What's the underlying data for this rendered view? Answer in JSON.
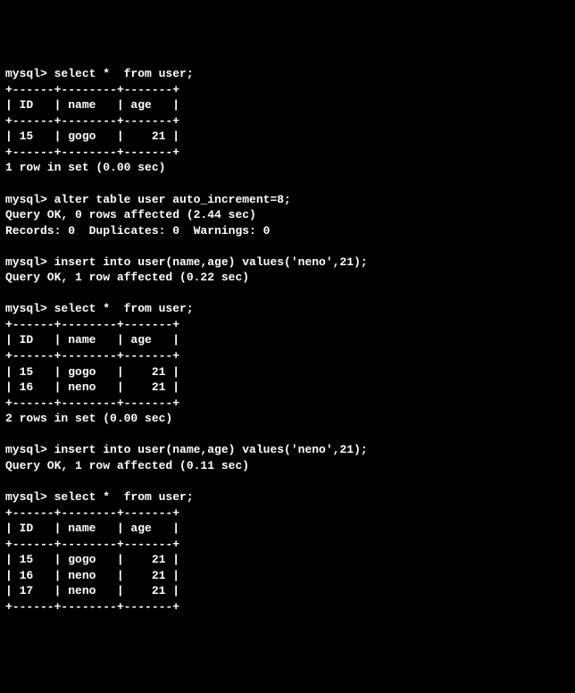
{
  "prompt": "mysql> ",
  "blocks": [
    {
      "type": "cmd",
      "text": "select *  from user;"
    },
    {
      "type": "table",
      "cols": [
        "ID",
        "name",
        "age"
      ],
      "cws": [
        4,
        6,
        5
      ],
      "rows": [
        [
          "15",
          "gogo",
          "21"
        ]
      ]
    },
    {
      "type": "line",
      "text": "1 row in set (0.00 sec)"
    },
    {
      "type": "blank"
    },
    {
      "type": "cmd",
      "text": "alter table user auto_increment=8;"
    },
    {
      "type": "line",
      "text": "Query OK, 0 rows affected (2.44 sec)"
    },
    {
      "type": "line",
      "text": "Records: 0  Duplicates: 0  Warnings: 0"
    },
    {
      "type": "blank"
    },
    {
      "type": "cmd",
      "text": "insert into user(name,age) values('neno',21);"
    },
    {
      "type": "line",
      "text": "Query OK, 1 row affected (0.22 sec)"
    },
    {
      "type": "blank"
    },
    {
      "type": "cmd",
      "text": "select *  from user;"
    },
    {
      "type": "table",
      "cols": [
        "ID",
        "name",
        "age"
      ],
      "cws": [
        4,
        6,
        5
      ],
      "rows": [
        [
          "15",
          "gogo",
          "21"
        ],
        [
          "16",
          "neno",
          "21"
        ]
      ]
    },
    {
      "type": "line",
      "text": "2 rows in set (0.00 sec)"
    },
    {
      "type": "blank"
    },
    {
      "type": "cmd",
      "text": "insert into user(name,age) values('neno',21);"
    },
    {
      "type": "line",
      "text": "Query OK, 1 row affected (0.11 sec)"
    },
    {
      "type": "blank"
    },
    {
      "type": "cmd",
      "text": "select *  from user;"
    },
    {
      "type": "table",
      "cols": [
        "ID",
        "name",
        "age"
      ],
      "cws": [
        4,
        6,
        5
      ],
      "rows": [
        [
          "15",
          "gogo",
          "21"
        ],
        [
          "16",
          "neno",
          "21"
        ],
        [
          "17",
          "neno",
          "21"
        ]
      ]
    }
  ]
}
